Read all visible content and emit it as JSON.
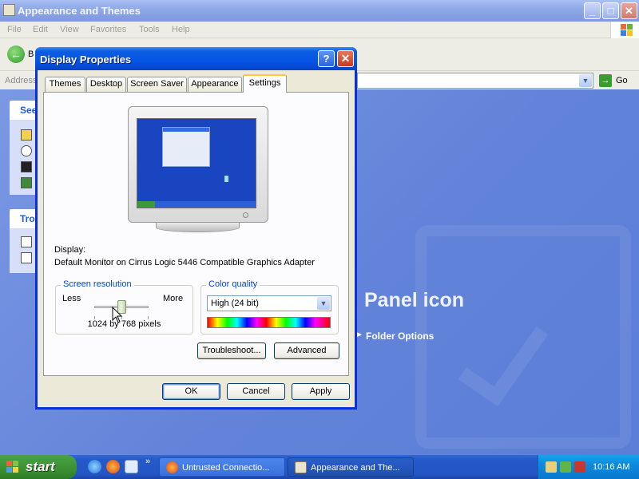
{
  "explorer": {
    "title": "Appearance and Themes",
    "menu": [
      "File",
      "Edit",
      "View",
      "Favorites",
      "Tools",
      "Help"
    ],
    "back_label": "B",
    "address_label": "Address",
    "go_label": "Go",
    "see_also_header": "See",
    "troubleshooters_header": "Tro",
    "panel_title": "Panel icon",
    "folder_options": "Folder Options"
  },
  "dialog": {
    "title": "Display Properties",
    "help_symbol": "?",
    "close_symbol": "✕",
    "tabs": [
      "Themes",
      "Desktop",
      "Screen Saver",
      "Appearance",
      "Settings"
    ],
    "active_tab": "Settings",
    "display_label": "Display:",
    "display_value": "Default Monitor on Cirrus Logic 5446 Compatible Graphics Adapter",
    "resolution": {
      "legend": "Screen resolution",
      "less": "Less",
      "more": "More",
      "value": "1024 by 768 pixels",
      "slider_position": 0.5
    },
    "color_quality": {
      "legend": "Color quality",
      "selected": "High (24 bit)"
    },
    "troubleshoot_button": "Troubleshoot...",
    "advanced_button": "Advanced",
    "ok_button": "OK",
    "cancel_button": "Cancel",
    "apply_button": "Apply"
  },
  "taskbar": {
    "start_label": "start",
    "tasks": [
      {
        "label": "Untrusted Connectio..."
      },
      {
        "label": "Appearance and The..."
      }
    ],
    "quick_launch_more": "»",
    "clock": "10:16 AM"
  },
  "colors": {
    "xp_title_blue": "#0a5ee0",
    "taskbar_blue": "#2455c4",
    "start_green": "#3c8f33",
    "dialog_face": "#ece9d8",
    "groupbox_legend": "#0046d5"
  }
}
